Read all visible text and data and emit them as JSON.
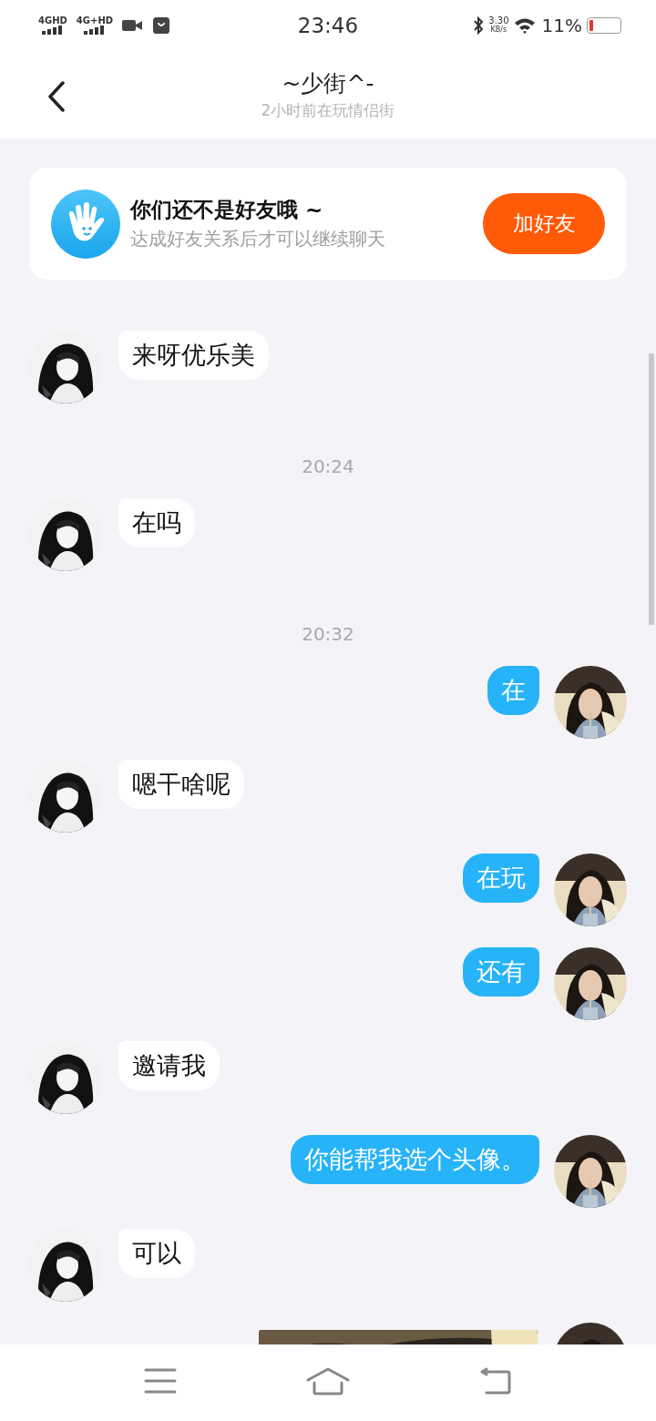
{
  "status_bar": {
    "signal_1": "4GHD",
    "signal_2": "4G+HD",
    "time": "23:46",
    "speed": "3.30",
    "speed_unit": "KB/s",
    "battery": "11%"
  },
  "header": {
    "title": "~少街^-",
    "subtitle": "2小时前在玩情侣街"
  },
  "friend_banner": {
    "title": "你们还不是好友哦 ~",
    "text": "达成好友关系后才可以继续聊天",
    "button": "加好友"
  },
  "messages": [
    {
      "kind": "received",
      "text": "来呀优乐美"
    },
    {
      "kind": "time",
      "text": "20:24"
    },
    {
      "kind": "received",
      "text": "在吗"
    },
    {
      "kind": "time",
      "text": "20:32"
    },
    {
      "kind": "sent",
      "text": "在"
    },
    {
      "kind": "received",
      "text": "嗯干啥呢"
    },
    {
      "kind": "sent",
      "text": "在玩"
    },
    {
      "kind": "sent",
      "text": "还有"
    },
    {
      "kind": "received",
      "text": "邀请我"
    },
    {
      "kind": "sent",
      "text": "你能帮我选个头像。"
    },
    {
      "kind": "received",
      "text": "可以"
    },
    {
      "kind": "sent_image"
    }
  ]
}
